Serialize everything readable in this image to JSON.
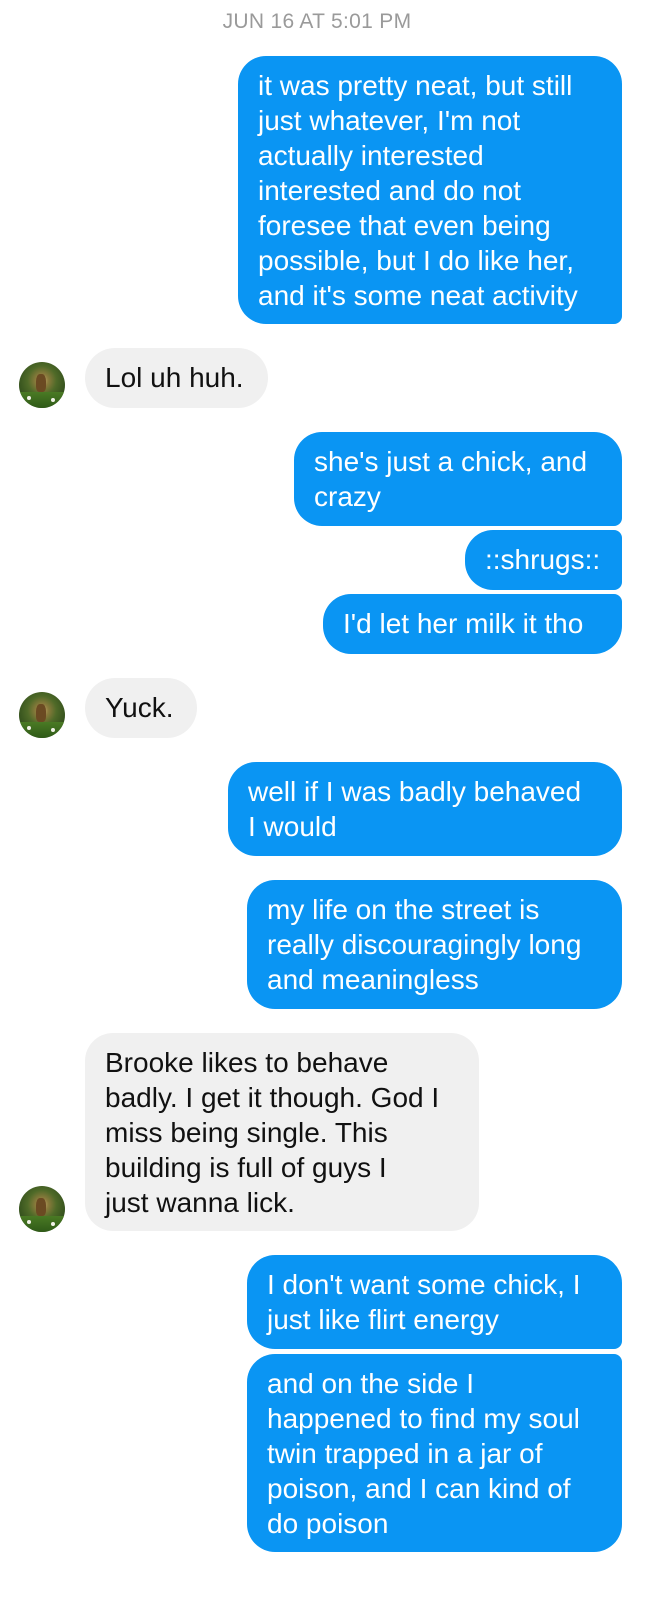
{
  "timestamp": "JUN 16 AT 5:01 PM",
  "contact_avatar": "contact-avatar-photo",
  "colors": {
    "outgoing_bubble": "#0a95f3",
    "incoming_bubble": "#f0f0f0",
    "timestamp_text": "#9a9a9a"
  },
  "messages": [
    {
      "direction": "outgoing",
      "text": "it was pretty neat, but still\njust whatever, I'm not\nactually interested\ninterested and do not\nforesee that even being\npossible, but I do like her,\nand it's some neat activity"
    },
    {
      "direction": "incoming",
      "text": "Lol uh huh."
    },
    {
      "direction": "outgoing",
      "text": "she's just a chick, and\ncrazy"
    },
    {
      "direction": "outgoing",
      "text": "::shrugs::"
    },
    {
      "direction": "outgoing",
      "text": "I'd let her milk it tho"
    },
    {
      "direction": "incoming",
      "text": "Yuck."
    },
    {
      "direction": "outgoing",
      "text": "well if I was badly behaved\nI would"
    },
    {
      "direction": "outgoing",
      "text": "my life on the street is\nreally discouragingly long\nand meaningless"
    },
    {
      "direction": "incoming",
      "text": "Brooke likes to behave\nbadly. I get it though. God I\nmiss being single. This\nbuilding is full of guys I\njust wanna lick."
    },
    {
      "direction": "outgoing",
      "text": "I don't want some chick, I\njust like flirt energy"
    },
    {
      "direction": "outgoing",
      "text": "and on the side I\nhappened to find my soul\ntwin trapped in a jar of\npoison, and I can kind of\ndo poison"
    }
  ]
}
